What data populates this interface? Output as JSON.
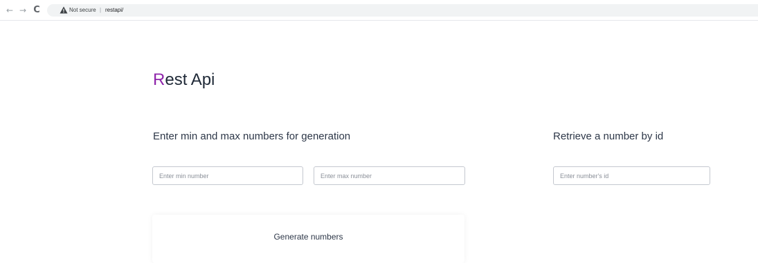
{
  "browser": {
    "nav_back_icon": "←",
    "nav_forward_icon": "→",
    "reload_icon": "C",
    "security_label": "Not secure",
    "separator": "|",
    "url": "restapi/"
  },
  "page": {
    "title_first_letter": "R",
    "title_rest": "est Api",
    "accent_color": "#8e24aa"
  },
  "generation": {
    "heading": "Enter min and max numbers for generation",
    "min_placeholder": "Enter min number",
    "max_placeholder": "Enter max number",
    "button_label": "Generate numbers"
  },
  "retrieve": {
    "heading": "Retrieve a number by id",
    "id_placeholder": "Enter number's id"
  }
}
